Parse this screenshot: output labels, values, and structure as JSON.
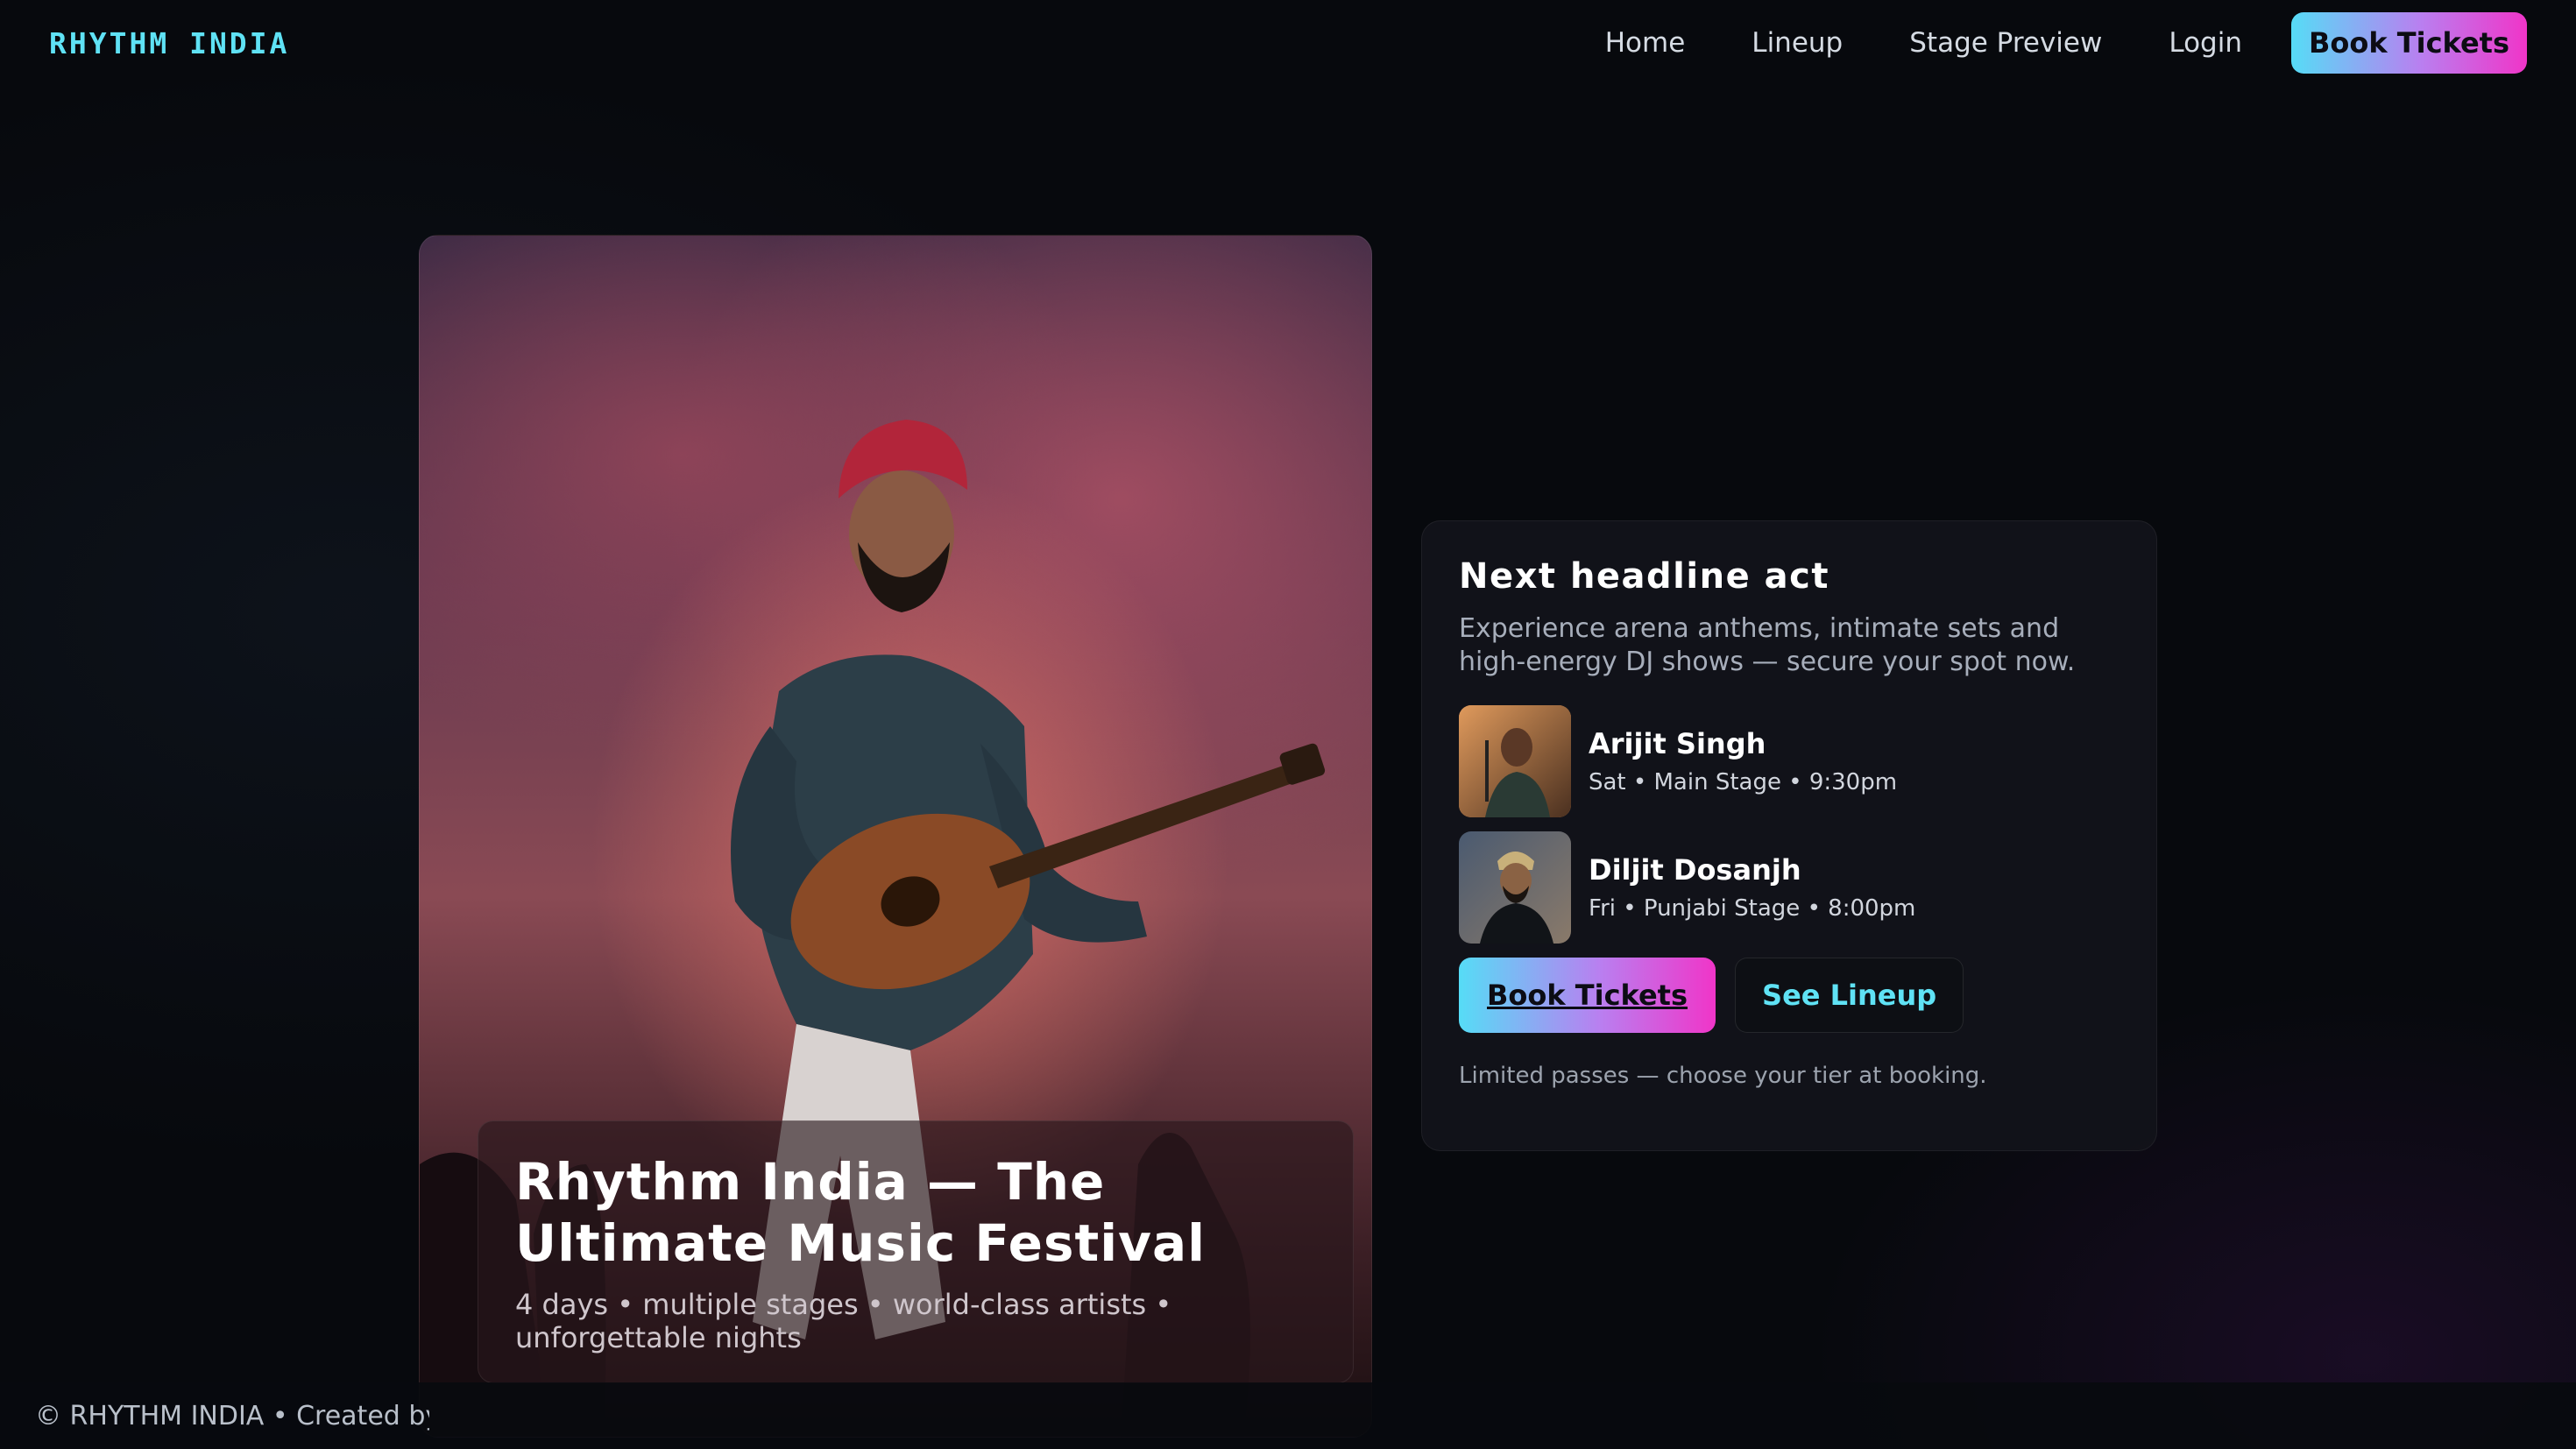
{
  "nav": {
    "brand": "RHYTHM INDIA",
    "links": [
      "Home",
      "Lineup",
      "Stage Preview",
      "Login"
    ],
    "cta": "Book Tickets"
  },
  "hero": {
    "title": "Rhythm India — The Ultimate Music Festival",
    "subtitle": "4 days • multiple stages • world-class artists • unforgettable nights"
  },
  "card": {
    "title": "Next headline act",
    "description": "Experience arena anthems, intimate sets and high-energy DJ shows — secure your spot now.",
    "acts": [
      {
        "name": "Arijit Singh",
        "meta": "Sat • Main Stage • 9:30pm"
      },
      {
        "name": "Diljit Dosanjh",
        "meta": "Fri • Punjabi Stage • 8:00pm"
      }
    ],
    "primary_button": "Book Tickets",
    "secondary_button": "See Lineup",
    "note": "Limited passes — choose your tier at booking."
  },
  "footer": {
    "text": "© RHYTHM INDIA • Created by"
  },
  "colors": {
    "accent_cyan": "#5fe2f5",
    "accent_pink": "#f035c8",
    "background": "#07090d"
  }
}
